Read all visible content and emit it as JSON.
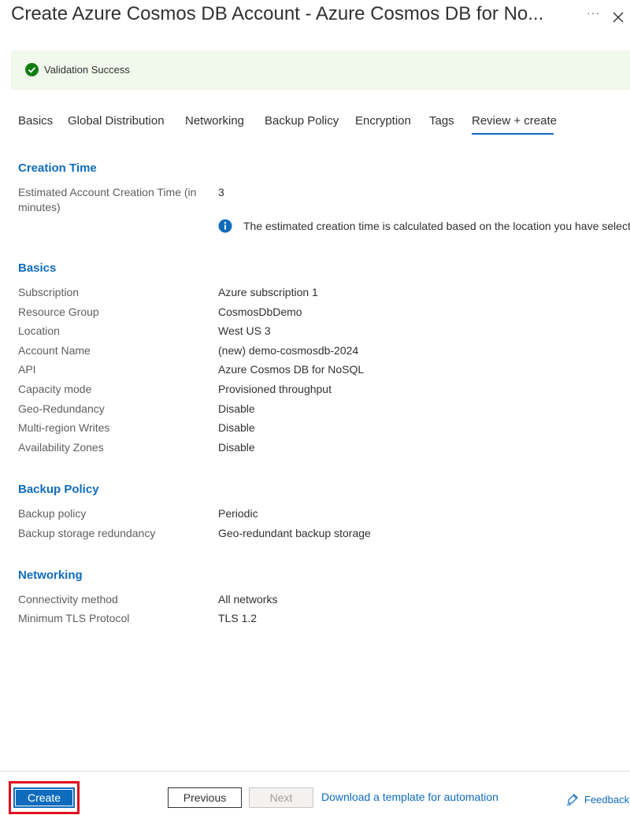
{
  "header": {
    "title": "Create Azure Cosmos DB Account - Azure Cosmos DB for No...",
    "more_label": "···"
  },
  "banner": {
    "text": "Validation Success",
    "icon": "checkmark-circle-icon",
    "color": "#107c10"
  },
  "tabs": [
    {
      "label": "Basics"
    },
    {
      "label": "Global Distribution"
    },
    {
      "label": "Networking"
    },
    {
      "label": "Backup Policy"
    },
    {
      "label": "Encryption"
    },
    {
      "label": "Tags"
    },
    {
      "label": "Review + create",
      "active": true
    }
  ],
  "creation_time": {
    "heading": "Creation Time",
    "label_line1": "Estimated Account Creation Time (in",
    "label_line2": "minutes)",
    "value": "3",
    "info": "The estimated creation time is calculated based on the location you have selected"
  },
  "basics": {
    "heading": "Basics",
    "rows": [
      {
        "label": "Subscription",
        "value": "Azure subscription 1"
      },
      {
        "label": "Resource Group",
        "value": "CosmosDbDemo"
      },
      {
        "label": "Location",
        "value": "West US 3"
      },
      {
        "label": "Account Name",
        "value": "(new) demo-cosmosdb-2024"
      },
      {
        "label": "API",
        "value": "Azure Cosmos DB for NoSQL"
      },
      {
        "label": "Capacity mode",
        "value": "Provisioned throughput"
      },
      {
        "label": "Geo-Redundancy",
        "value": "Disable"
      },
      {
        "label": "Multi-region Writes",
        "value": "Disable"
      },
      {
        "label": "Availability Zones",
        "value": "Disable"
      }
    ]
  },
  "backup": {
    "heading": "Backup Policy",
    "rows": [
      {
        "label": "Backup policy",
        "value": "Periodic"
      },
      {
        "label": "Backup storage redundancy",
        "value": "Geo-redundant backup storage"
      }
    ]
  },
  "networking": {
    "heading": "Networking",
    "rows": [
      {
        "label": "Connectivity method",
        "value": "All networks"
      },
      {
        "label": "Minimum TLS Protocol",
        "value": "TLS 1.2"
      }
    ]
  },
  "footer": {
    "create_label": "Create",
    "previous_label": "Previous",
    "next_label": "Next",
    "download_label": "Download a template for automation",
    "feedback_label": "Feedback"
  },
  "colors": {
    "accent": "#0f6cbd",
    "success": "#107c10",
    "highlight": "#e00b1c"
  }
}
